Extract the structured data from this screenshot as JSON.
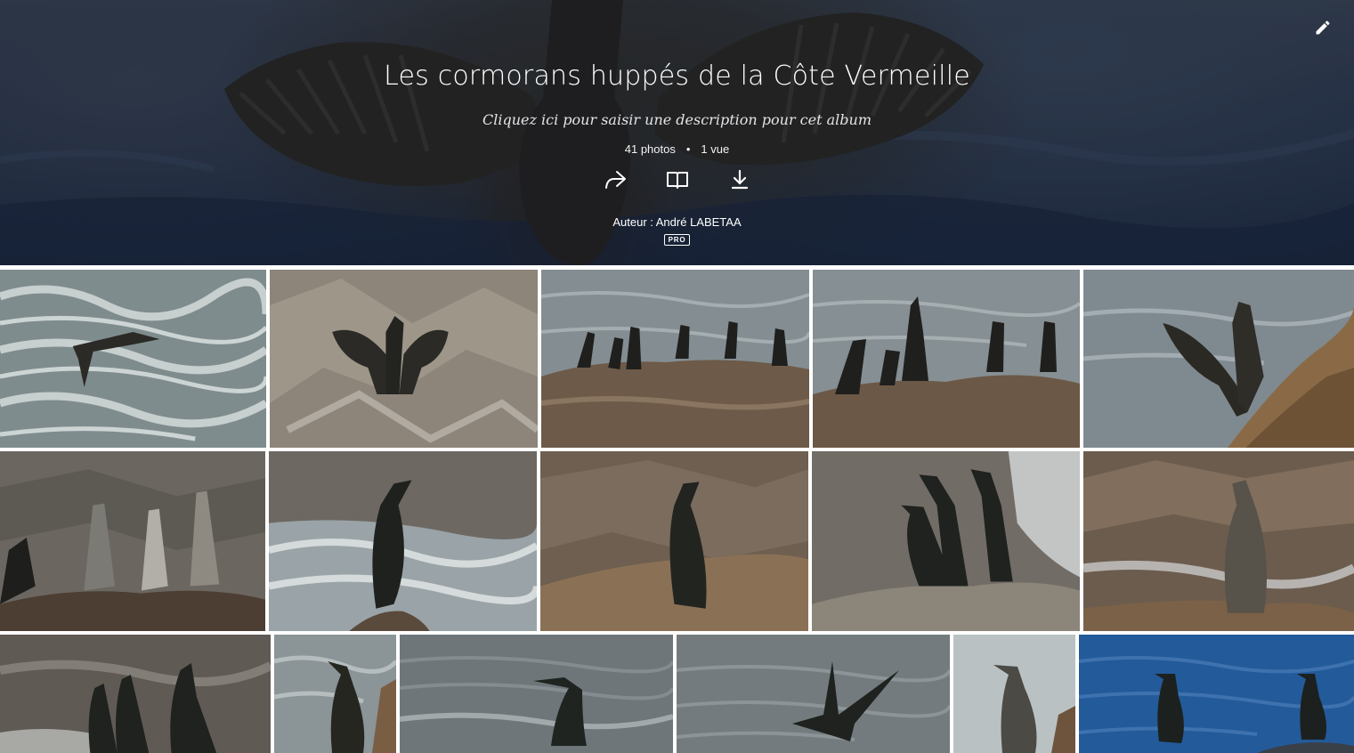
{
  "album": {
    "title": "Les cormorans huppés de la Côte Vermeille",
    "description_placeholder": "Cliquez ici pour saisir une description pour cet album",
    "photo_count": "41 photos",
    "separator": "•",
    "views": "1 vue",
    "author_prefix": "Auteur : ",
    "author_name": "André LABETAA",
    "author_badge": "PRO"
  },
  "icons": {
    "edit": "pencil-icon",
    "share": "share-arrow-icon",
    "slideshow": "open-book-icon",
    "download": "download-icon"
  },
  "colors": {
    "header_overlay": "#1a2840",
    "text": "#ffffff",
    "page_background": "#ffffff"
  },
  "photos": [
    {
      "scene": "sea-flight"
    },
    {
      "scene": "rock-wings"
    },
    {
      "scene": "rock-group"
    },
    {
      "scene": "rock-group-2"
    },
    {
      "scene": "sea-wings"
    },
    {
      "scene": "rock-trio"
    },
    {
      "scene": "surf-single"
    },
    {
      "scene": "rock-single"
    },
    {
      "scene": "surf-trio"
    },
    {
      "scene": "rock-juvenile"
    },
    {
      "scene": "rock-trio-dark"
    },
    {
      "scene": "sea-single"
    },
    {
      "scene": "swimming"
    },
    {
      "scene": "landing"
    },
    {
      "scene": "sky-single"
    },
    {
      "scene": "blue-sea-pair"
    }
  ]
}
